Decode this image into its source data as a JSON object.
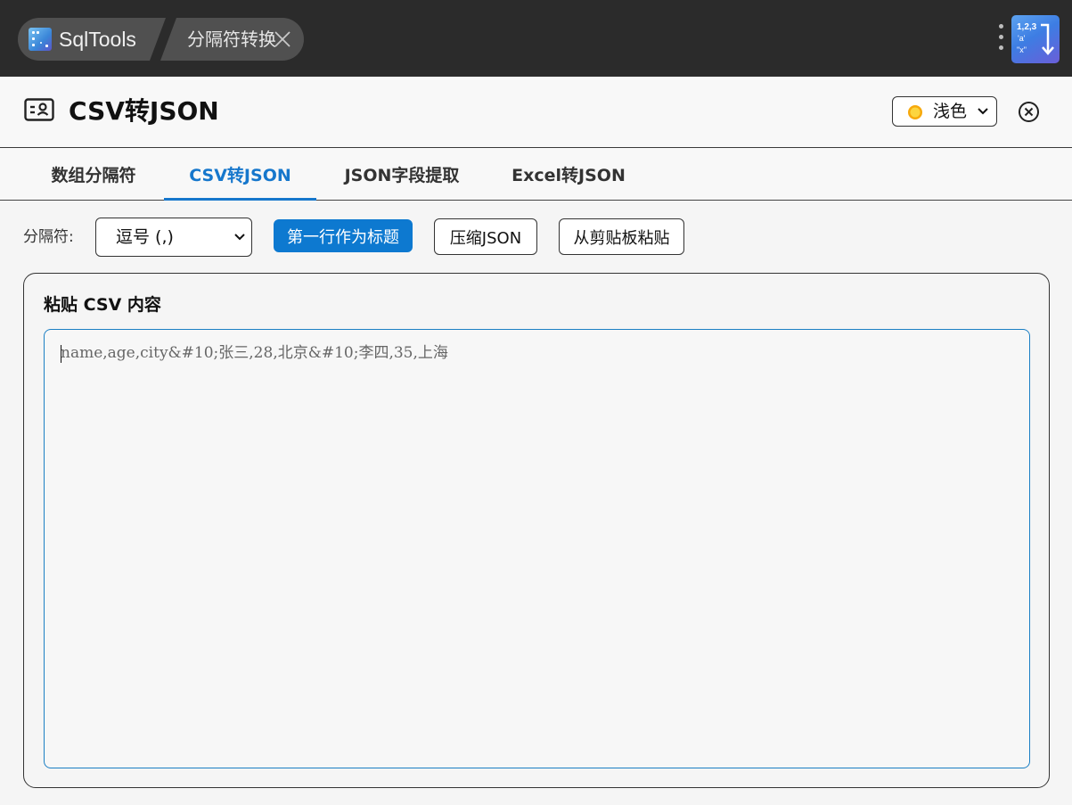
{
  "titlebar": {
    "app_name": "SqlTools",
    "tab_title": "分隔符转换",
    "badge": {
      "line1": "1,2,3",
      "line2": "'a'",
      "line3": "\"x\""
    }
  },
  "header": {
    "title": "CSV转JSON",
    "theme_label": "浅色"
  },
  "tabs": [
    {
      "label": "数组分隔符"
    },
    {
      "label": "CSV转JSON",
      "active": true
    },
    {
      "label": "JSON字段提取"
    },
    {
      "label": "Excel转JSON"
    }
  ],
  "toolbar": {
    "separator_label": "分隔符:",
    "separator_value": "逗号 (,)",
    "header_row_button": "第一行作为标题",
    "compress_button": "压缩JSON",
    "paste_button": "从剪贴板粘贴"
  },
  "panel": {
    "title": "粘贴 CSV 内容",
    "placeholder": "name,age,city&#10;张三,28,北京&#10;李四,35,上海"
  },
  "colors": {
    "accent": "#1677cc",
    "primary_button": "#0d79d0",
    "titlebar_bg": "#2b2b2b",
    "window_bg": "#f5f5f5"
  }
}
